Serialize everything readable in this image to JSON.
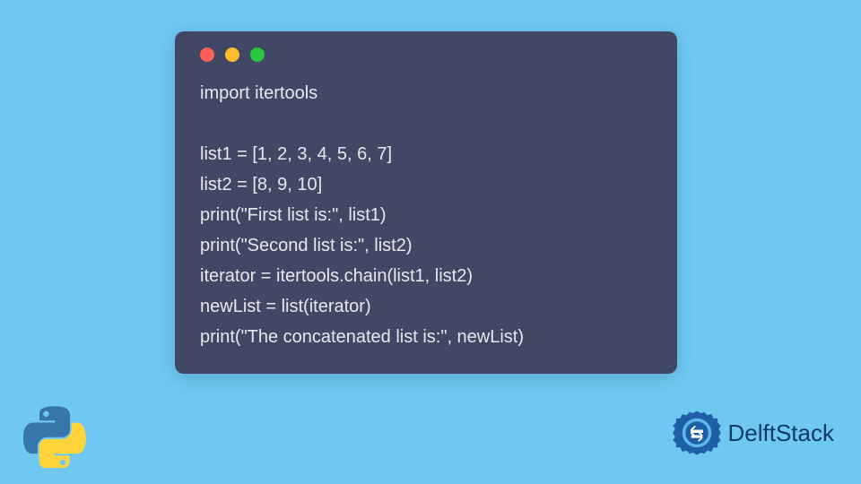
{
  "code": {
    "lines": [
      "import itertools",
      "",
      "list1 = [1, 2, 3, 4, 5, 6, 7]",
      "list2 = [8, 9, 10]",
      "print(\"First list is:\", list1)",
      "print(\"Second list is:\", list2)",
      "iterator = itertools.chain(list1, list2)",
      "newList = list(iterator)",
      "print(\"The concatenated list is:\", newList)"
    ]
  },
  "branding": {
    "delft_name": "DelftStack"
  },
  "icons": {
    "window_close": "red",
    "window_minimize": "yellow",
    "window_maximize": "green"
  }
}
